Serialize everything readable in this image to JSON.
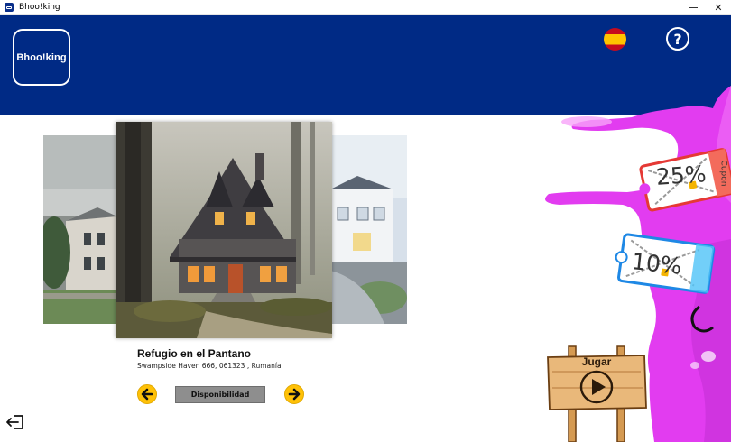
{
  "window": {
    "title": "Bhoo!king",
    "app_icon": "app-icon",
    "minimize_icon": "minimize-icon",
    "close_icon": "close-icon",
    "close_glyph": "✕"
  },
  "header": {
    "background": "#002a85",
    "logo_text": "Bhoo!king",
    "language_flag": "spain-flag-icon",
    "help_glyph": "?"
  },
  "carousel": {
    "current": {
      "name": "Refugio en el Pantano",
      "address": "Swampside Haven 666, 061323 , Rumanía"
    },
    "availability_label": "Disponibilidad",
    "prev_icon": "arrow-left-icon",
    "next_icon": "arrow-right-icon",
    "accent": "#ffc107"
  },
  "footer": {
    "exit_icon": "logout-icon"
  },
  "promo": {
    "coupons": [
      {
        "percent": "25%",
        "word": "Cupon"
      },
      {
        "percent": "10%"
      }
    ],
    "play_label": "Jugar",
    "play_icon": "play-icon",
    "slime_color": "#e23cf0"
  }
}
